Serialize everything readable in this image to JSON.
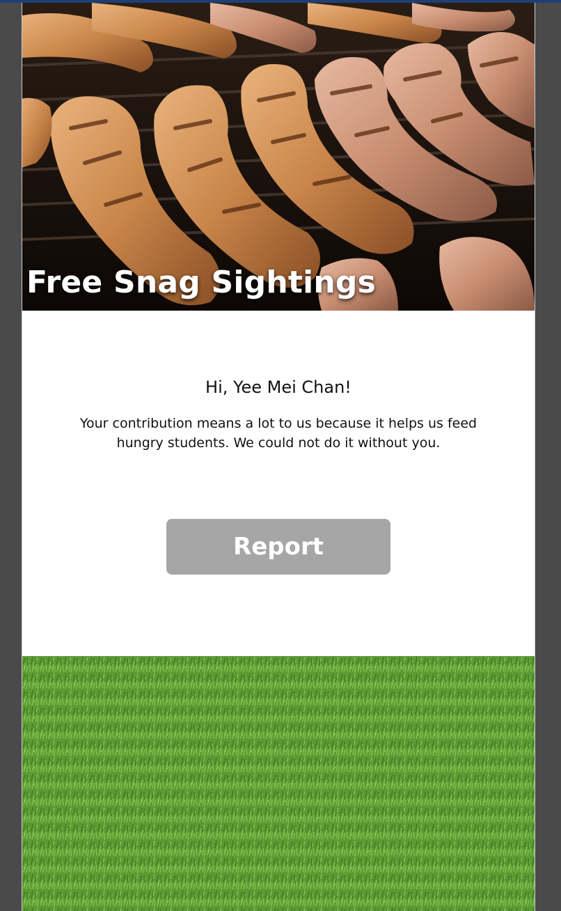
{
  "header": {
    "title": "Free Snag Sightings"
  },
  "main": {
    "greeting": "Hi, Yee Mei Chan!",
    "message": "Your contribution means a lot to us because it helps us feed hungry students. We could not do it without you.",
    "report_label": "Report"
  },
  "colors": {
    "accent_strip": "#1f3f74",
    "button_bg": "#a6a6a6",
    "button_text": "#ffffff",
    "grass": "#5c9a34"
  }
}
